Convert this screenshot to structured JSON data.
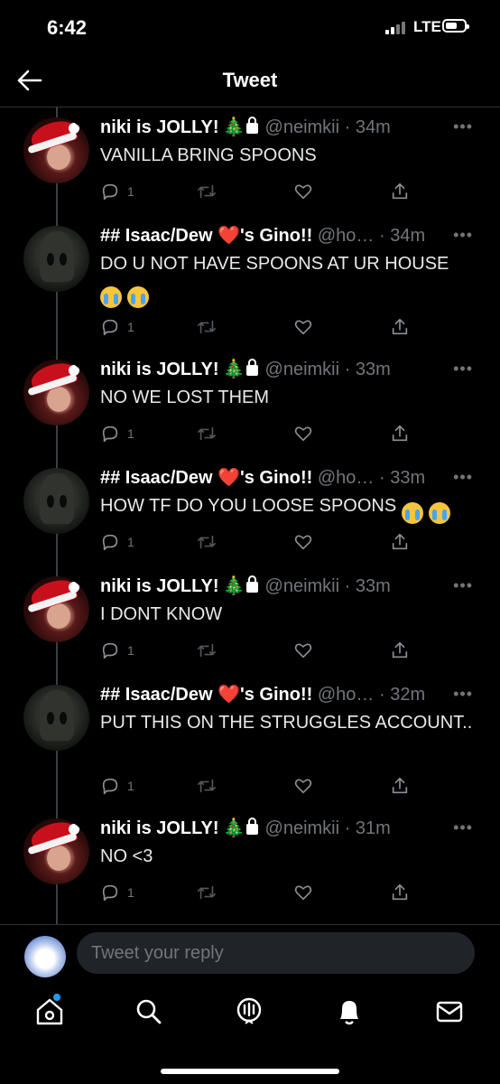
{
  "status_bar": {
    "time": "6:42",
    "network": "LTE"
  },
  "header": {
    "title": "Tweet"
  },
  "tweets": [
    {
      "name": "niki is JOLLY!",
      "name_emoji": "🎄",
      "locked": true,
      "handle": "@neimkii",
      "time": "34m",
      "text": "VANILLA BRING SPOONS",
      "replies": "1",
      "avatar": "santa-hat-avatar"
    },
    {
      "name": "## Isaac/Dew ❤️'s Gino!!",
      "locked": false,
      "handle": "@ho…",
      "time": "34m",
      "text": "DO U NOT HAVE SPOONS AT UR HOUSE",
      "emojis": [
        "😭",
        "😭"
      ],
      "replies": "1",
      "avatar": "hooded-figure-avatar"
    },
    {
      "name": "niki is JOLLY!",
      "name_emoji": "🎄",
      "locked": true,
      "handle": "@neimkii",
      "time": "33m",
      "text": "NO WE LOST THEM",
      "replies": "1",
      "avatar": "santa-hat-avatar"
    },
    {
      "name": "## Isaac/Dew ❤️'s Gino!!",
      "locked": false,
      "handle": "@ho…",
      "time": "33m",
      "text": "HOW TF DO YOU LOOSE SPOONS",
      "emojis": [
        "😭",
        "😭"
      ],
      "replies": "1",
      "avatar": "hooded-figure-avatar"
    },
    {
      "name": "niki is JOLLY!",
      "name_emoji": "🎄",
      "locked": true,
      "handle": "@neimkii",
      "time": "33m",
      "text": "I DONT KNOW",
      "replies": "1",
      "avatar": "santa-hat-avatar"
    },
    {
      "name": "## Isaac/Dew ❤️'s Gino!!",
      "locked": false,
      "handle": "@ho…",
      "time": "32m",
      "text": "PUT THIS ON THE STRUGGLES ACCOUNT..",
      "replies": "1",
      "avatar": "hooded-figure-avatar"
    },
    {
      "name": "niki is JOLLY!",
      "name_emoji": "🎄",
      "locked": true,
      "handle": "@neimkii",
      "time": "31m",
      "text": "NO <3",
      "replies": "1",
      "avatar": "santa-hat-avatar"
    }
  ],
  "composer": {
    "placeholder": "Tweet your reply"
  },
  "tabs": [
    "home-icon",
    "search-icon",
    "spaces-icon",
    "notifications-icon",
    "messages-icon"
  ],
  "colors": {
    "background": "#000000",
    "text": "#e7e9ea",
    "secondary": "#71767b",
    "accent": "#1d9bf0"
  }
}
